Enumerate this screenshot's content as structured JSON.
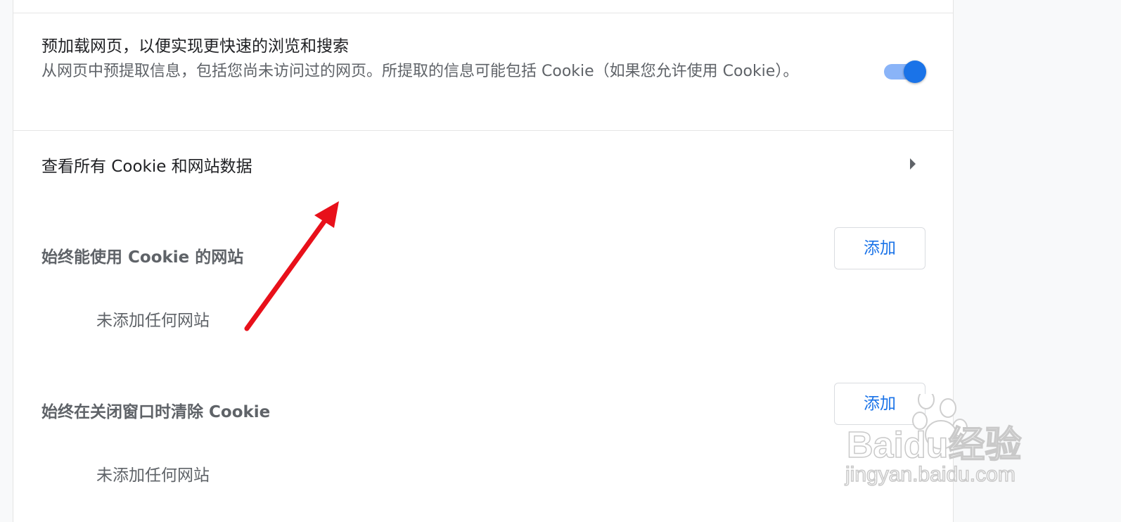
{
  "preload": {
    "title": "预加载网页，以便实现更快速的浏览和搜索",
    "description": "从网页中预提取信息，包括您尚未访问过的网页。所提取的信息可能包括 Cookie（如果您允许使用 Cookie）。",
    "toggle_on": true
  },
  "view_all": {
    "label": "查看所有 Cookie 和网站数据"
  },
  "allow_section": {
    "title": "始终能使用 Cookie 的网站",
    "add_label": "添加",
    "empty_text": "未添加任何网站"
  },
  "clear_section": {
    "title": "始终在关闭窗口时清除 Cookie",
    "add_label": "添加",
    "empty_text": "未添加任何网站"
  },
  "watermark": {
    "brand": "Baidu经验",
    "url": "jingyan.baidu.com"
  },
  "colors": {
    "accent": "#1a73e8",
    "toggle_track": "#8ab4f8",
    "annotation_arrow": "#e8101a"
  }
}
